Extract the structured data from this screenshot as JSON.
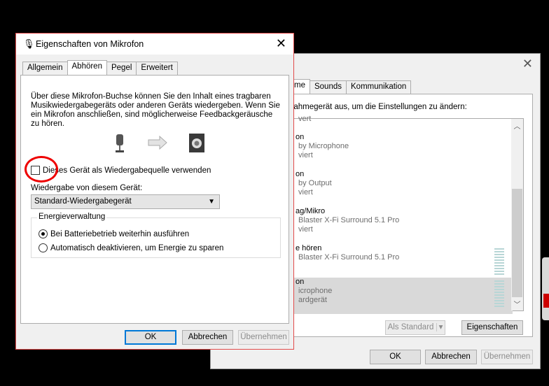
{
  "back_window": {
    "tabs": [
      {
        "label": "me"
      },
      {
        "label": "Sounds"
      },
      {
        "label": "Kommunikation"
      }
    ],
    "intro": "nahmegerät aus, um die Einstellungen zu ändern:",
    "devices": [
      {
        "name": "vert",
        "sub1": "",
        "sub2": ""
      },
      {
        "name": "on",
        "sub1": "by Microphone",
        "sub2": "viert"
      },
      {
        "name": "on",
        "sub1": "by Output",
        "sub2": "viert"
      },
      {
        "name": "ag/Mikro",
        "sub1": "Blaster X-Fi Surround 5.1 Pro",
        "sub2": "viert"
      },
      {
        "name": "e hören",
        "sub1": "Blaster X-Fi Surround 5.1 Pro",
        "sub2": ""
      },
      {
        "name": "on",
        "sub1": "icrophone",
        "sub2": "ardgerät"
      }
    ],
    "buttons": {
      "als_standard": "Als Standard",
      "eigenschaften": "Eigenschaften",
      "ok": "OK",
      "abbrechen": "Abbrechen",
      "uebernehmen": "Übernehmen"
    }
  },
  "front_window": {
    "title": "Eigenschaften von Mikrofon",
    "tabs": [
      {
        "label": "Allgemein"
      },
      {
        "label": "Abhören"
      },
      {
        "label": "Pegel"
      },
      {
        "label": "Erweitert"
      }
    ],
    "description": "Über diese Mikrofon-Buchse können Sie den Inhalt eines tragbaren Musikwiedergabegeräts oder anderen Geräts wiedergeben. Wenn Sie ein Mikrofon anschließen, sind möglicherweise Feedbackgeräusche zu hören.",
    "checkbox_label": "Dieses Gerät als Wiedergabequelle verwenden",
    "checkbox_checked": false,
    "playback_label": "Wiedergabe von diesem Gerät:",
    "playback_value": "Standard-Wiedergabegerät",
    "energy_title": "Energieverwaltung",
    "radio_1": "Bei Batteriebetrieb weiterhin ausführen",
    "radio_2": "Automatisch deaktivieren, um Energie zu sparen",
    "buttons": {
      "ok": "OK",
      "abbrechen": "Abbrechen",
      "uebernehmen": "Übernehmen"
    }
  }
}
